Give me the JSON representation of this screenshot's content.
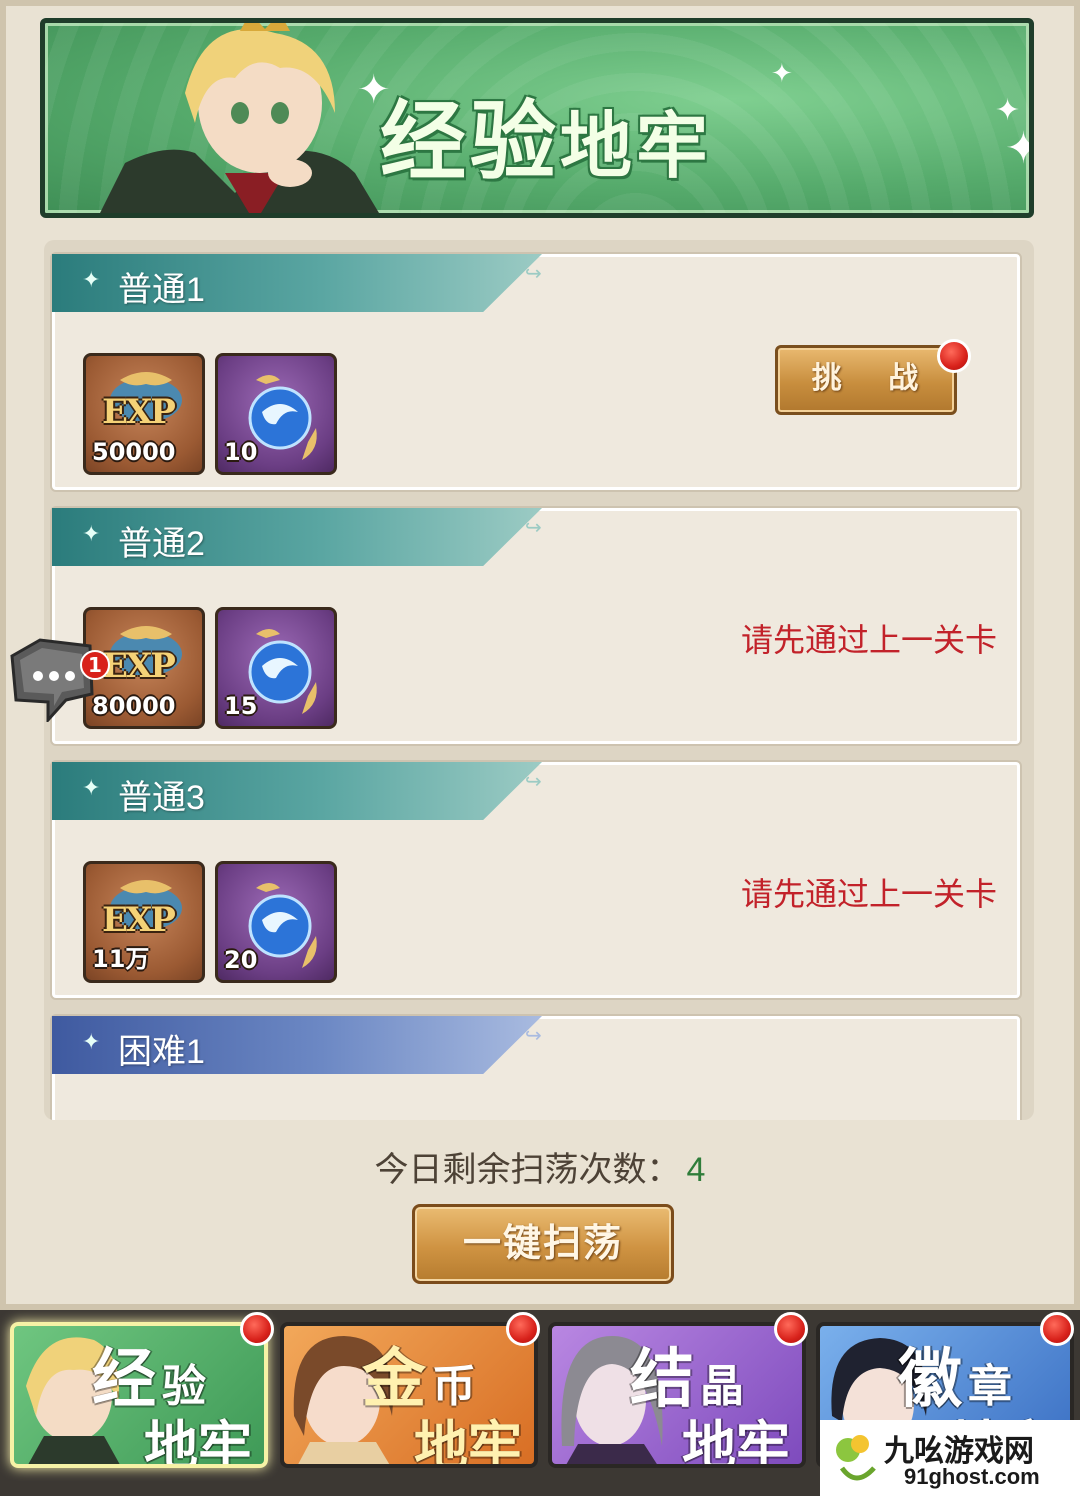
{
  "banner": {
    "title_big": "经验",
    "title_small": "地牢"
  },
  "stages": [
    {
      "label": "普通1",
      "type": "normal",
      "rewards": [
        {
          "kind": "exp",
          "icon": "exp-scroll-icon",
          "count": "50000"
        },
        {
          "kind": "orb",
          "icon": "blue-orb-icon",
          "count": "10"
        }
      ],
      "action": "challenge",
      "button_label": "挑 战",
      "has_notification": true
    },
    {
      "label": "普通2",
      "type": "normal",
      "rewards": [
        {
          "kind": "exp",
          "icon": "exp-scroll-icon",
          "count": "80000"
        },
        {
          "kind": "orb",
          "icon": "blue-orb-icon",
          "count": "15"
        }
      ],
      "action": "locked",
      "locked_text": "请先通过上一关卡"
    },
    {
      "label": "普通3",
      "type": "normal",
      "rewards": [
        {
          "kind": "exp",
          "icon": "exp-scroll-icon",
          "count": "11万"
        },
        {
          "kind": "orb",
          "icon": "blue-orb-icon",
          "count": "20"
        }
      ],
      "action": "locked",
      "locked_text": "请先通过上一关卡"
    },
    {
      "label": "困难1",
      "type": "hard"
    }
  ],
  "chat": {
    "badge_count": "1",
    "icon": "chat-bubble-icon"
  },
  "sweep": {
    "info_label": "今日剩余扫荡次数：",
    "remaining": "4",
    "button_label": "一键扫荡"
  },
  "tabs": [
    {
      "name": "exp",
      "t1": "经",
      "t2": "验",
      "t3": "地牢",
      "active": true
    },
    {
      "name": "gold",
      "t1": "金",
      "t2": "币",
      "t3": "地牢",
      "active": false
    },
    {
      "name": "crystal",
      "t1": "结",
      "t2": "晶",
      "t3": "地牢",
      "active": false
    },
    {
      "name": "badge",
      "t1": "徽",
      "t2": "章",
      "t3": "地牢",
      "active": false
    }
  ],
  "watermark": {
    "title": "九吆游戏网",
    "url": "91ghost.com"
  },
  "colors": {
    "banner_green": "#56ab6c",
    "locked_red": "#c2222a",
    "remaining_green": "#2f7d3a",
    "button_gold": "#cf9342"
  }
}
